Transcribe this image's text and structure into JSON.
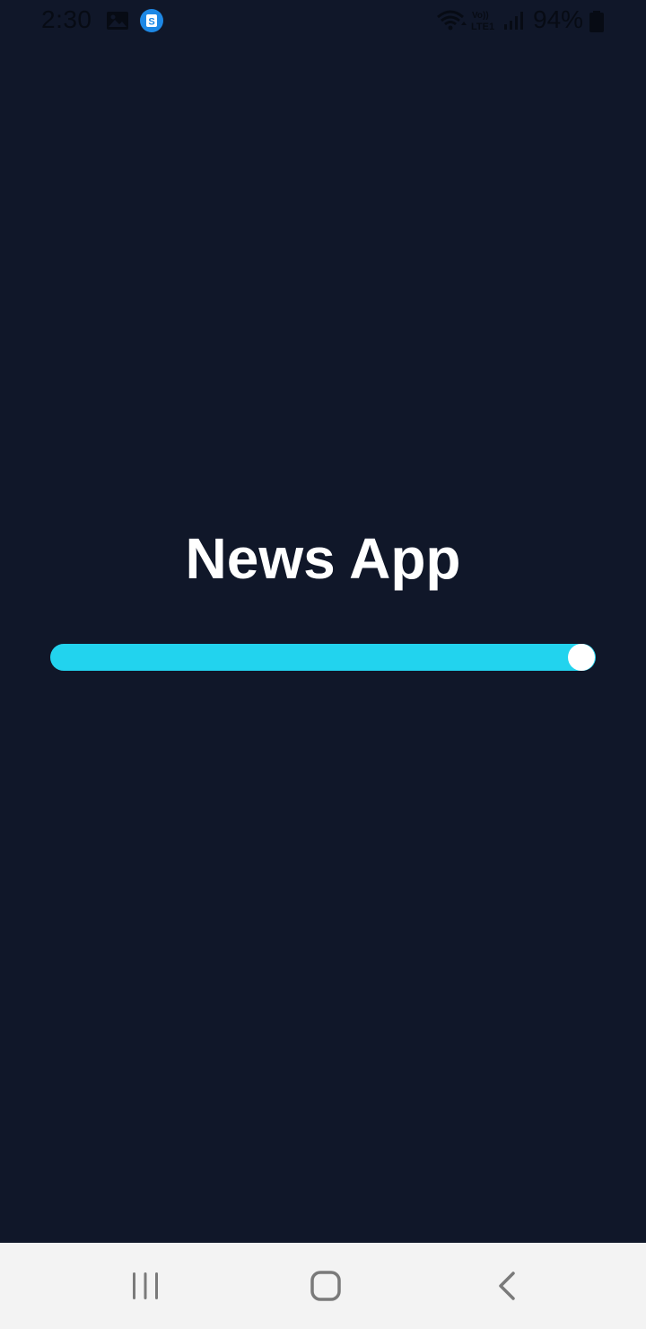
{
  "status_bar": {
    "time": "2:30",
    "battery": "94%",
    "icons": [
      "image-icon",
      "app-s-icon",
      "wifi-icon",
      "volte-lte-icon",
      "signal-icon",
      "battery-icon"
    ],
    "app_badge_letter": "S",
    "volte_top": "Vo))",
    "volte_bottom": "LTE1"
  },
  "splash": {
    "title": "News App",
    "progress": 1.0
  },
  "colors": {
    "background": "#101729",
    "accent": "#22d3ee",
    "knob": "#ffffff",
    "nav_background": "#f3f3f3",
    "nav_icon": "#7a7a7a"
  },
  "nav_bar": {
    "buttons": [
      "recents-icon",
      "home-icon",
      "back-icon"
    ]
  }
}
